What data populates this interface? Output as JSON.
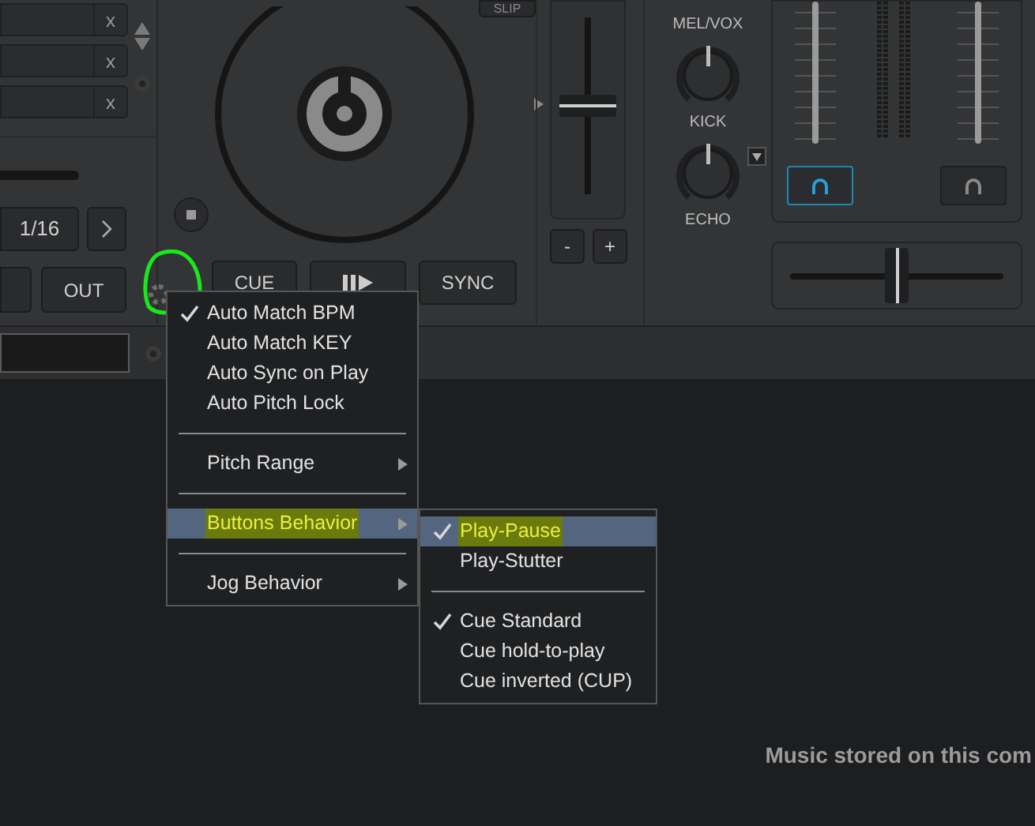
{
  "deck": {
    "search_fields": [
      {
        "clear": "x"
      },
      {
        "clear": "x"
      },
      {
        "clear": "x"
      }
    ],
    "slip_button": "SLIP",
    "progress": {
      "level": 0.5
    },
    "grid_value": "1/16",
    "out_button": "OUT",
    "cue_button": "CUE",
    "sync_button": "SYNC",
    "pitch": {
      "level": 0.5,
      "minus": "-",
      "plus": "+"
    }
  },
  "mixer": {
    "top_label": "MEL/VOX",
    "knobs": [
      {
        "label": "KICK",
        "dropdown": false
      },
      {
        "label": "ECHO",
        "dropdown": true
      }
    ],
    "headphones": [
      {
        "selected": true
      },
      {
        "selected": false
      }
    ],
    "crossfader": {
      "level": 0.5
    }
  },
  "menu": {
    "items": [
      {
        "kind": "item",
        "label": "Auto Match BPM",
        "checked": true,
        "submenu": false,
        "selected": false,
        "marked": false
      },
      {
        "kind": "item",
        "label": "Auto Match KEY",
        "checked": false,
        "submenu": false,
        "selected": false,
        "marked": false
      },
      {
        "kind": "item",
        "label": "Auto Sync on Play",
        "checked": false,
        "submenu": false,
        "selected": false,
        "marked": false
      },
      {
        "kind": "item",
        "label": "Auto Pitch Lock",
        "checked": false,
        "submenu": false,
        "selected": false,
        "marked": false
      },
      {
        "kind": "separator"
      },
      {
        "kind": "item",
        "label": "Pitch Range",
        "checked": false,
        "submenu": true,
        "selected": false,
        "marked": false
      },
      {
        "kind": "separator"
      },
      {
        "kind": "item",
        "label": "Buttons Behavior",
        "checked": false,
        "submenu": true,
        "selected": true,
        "marked": true
      },
      {
        "kind": "separator"
      },
      {
        "kind": "item",
        "label": "Jog Behavior",
        "checked": false,
        "submenu": true,
        "selected": false,
        "marked": false
      }
    ],
    "submenu": [
      {
        "kind": "item",
        "label": "Play-Pause",
        "checked": true,
        "selected": true,
        "marked": true
      },
      {
        "kind": "item",
        "label": "Play-Stutter",
        "checked": false,
        "selected": false,
        "marked": false
      },
      {
        "kind": "separator"
      },
      {
        "kind": "item",
        "label": "Cue Standard",
        "checked": true,
        "selected": false,
        "marked": false
      },
      {
        "kind": "item",
        "label": "Cue hold-to-play",
        "checked": false,
        "selected": false,
        "marked": false
      },
      {
        "kind": "item",
        "label": "Cue inverted (CUP)",
        "checked": false,
        "selected": false,
        "marked": false
      }
    ]
  },
  "footer_text": "Music stored on this com"
}
